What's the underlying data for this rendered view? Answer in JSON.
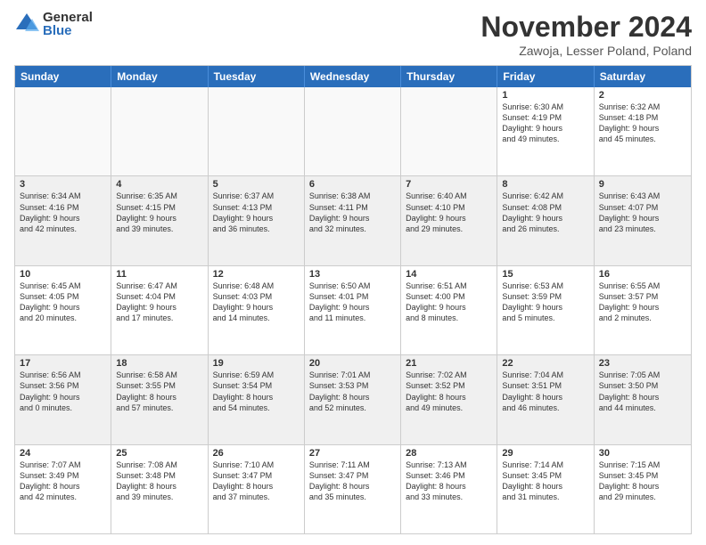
{
  "logo": {
    "general": "General",
    "blue": "Blue"
  },
  "title": {
    "month": "November 2024",
    "location": "Zawoja, Lesser Poland, Poland"
  },
  "calendar": {
    "headers": [
      "Sunday",
      "Monday",
      "Tuesday",
      "Wednesday",
      "Thursday",
      "Friday",
      "Saturday"
    ],
    "rows": [
      [
        {
          "day": "",
          "info": "",
          "empty": true
        },
        {
          "day": "",
          "info": "",
          "empty": true
        },
        {
          "day": "",
          "info": "",
          "empty": true
        },
        {
          "day": "",
          "info": "",
          "empty": true
        },
        {
          "day": "",
          "info": "",
          "empty": true
        },
        {
          "day": "1",
          "info": "Sunrise: 6:30 AM\nSunset: 4:19 PM\nDaylight: 9 hours\nand 49 minutes."
        },
        {
          "day": "2",
          "info": "Sunrise: 6:32 AM\nSunset: 4:18 PM\nDaylight: 9 hours\nand 45 minutes."
        }
      ],
      [
        {
          "day": "3",
          "info": "Sunrise: 6:34 AM\nSunset: 4:16 PM\nDaylight: 9 hours\nand 42 minutes."
        },
        {
          "day": "4",
          "info": "Sunrise: 6:35 AM\nSunset: 4:15 PM\nDaylight: 9 hours\nand 39 minutes."
        },
        {
          "day": "5",
          "info": "Sunrise: 6:37 AM\nSunset: 4:13 PM\nDaylight: 9 hours\nand 36 minutes."
        },
        {
          "day": "6",
          "info": "Sunrise: 6:38 AM\nSunset: 4:11 PM\nDaylight: 9 hours\nand 32 minutes."
        },
        {
          "day": "7",
          "info": "Sunrise: 6:40 AM\nSunset: 4:10 PM\nDaylight: 9 hours\nand 29 minutes."
        },
        {
          "day": "8",
          "info": "Sunrise: 6:42 AM\nSunset: 4:08 PM\nDaylight: 9 hours\nand 26 minutes."
        },
        {
          "day": "9",
          "info": "Sunrise: 6:43 AM\nSunset: 4:07 PM\nDaylight: 9 hours\nand 23 minutes."
        }
      ],
      [
        {
          "day": "10",
          "info": "Sunrise: 6:45 AM\nSunset: 4:05 PM\nDaylight: 9 hours\nand 20 minutes."
        },
        {
          "day": "11",
          "info": "Sunrise: 6:47 AM\nSunset: 4:04 PM\nDaylight: 9 hours\nand 17 minutes."
        },
        {
          "day": "12",
          "info": "Sunrise: 6:48 AM\nSunset: 4:03 PM\nDaylight: 9 hours\nand 14 minutes."
        },
        {
          "day": "13",
          "info": "Sunrise: 6:50 AM\nSunset: 4:01 PM\nDaylight: 9 hours\nand 11 minutes."
        },
        {
          "day": "14",
          "info": "Sunrise: 6:51 AM\nSunset: 4:00 PM\nDaylight: 9 hours\nand 8 minutes."
        },
        {
          "day": "15",
          "info": "Sunrise: 6:53 AM\nSunset: 3:59 PM\nDaylight: 9 hours\nand 5 minutes."
        },
        {
          "day": "16",
          "info": "Sunrise: 6:55 AM\nSunset: 3:57 PM\nDaylight: 9 hours\nand 2 minutes."
        }
      ],
      [
        {
          "day": "17",
          "info": "Sunrise: 6:56 AM\nSunset: 3:56 PM\nDaylight: 9 hours\nand 0 minutes."
        },
        {
          "day": "18",
          "info": "Sunrise: 6:58 AM\nSunset: 3:55 PM\nDaylight: 8 hours\nand 57 minutes."
        },
        {
          "day": "19",
          "info": "Sunrise: 6:59 AM\nSunset: 3:54 PM\nDaylight: 8 hours\nand 54 minutes."
        },
        {
          "day": "20",
          "info": "Sunrise: 7:01 AM\nSunset: 3:53 PM\nDaylight: 8 hours\nand 52 minutes."
        },
        {
          "day": "21",
          "info": "Sunrise: 7:02 AM\nSunset: 3:52 PM\nDaylight: 8 hours\nand 49 minutes."
        },
        {
          "day": "22",
          "info": "Sunrise: 7:04 AM\nSunset: 3:51 PM\nDaylight: 8 hours\nand 46 minutes."
        },
        {
          "day": "23",
          "info": "Sunrise: 7:05 AM\nSunset: 3:50 PM\nDaylight: 8 hours\nand 44 minutes."
        }
      ],
      [
        {
          "day": "24",
          "info": "Sunrise: 7:07 AM\nSunset: 3:49 PM\nDaylight: 8 hours\nand 42 minutes."
        },
        {
          "day": "25",
          "info": "Sunrise: 7:08 AM\nSunset: 3:48 PM\nDaylight: 8 hours\nand 39 minutes."
        },
        {
          "day": "26",
          "info": "Sunrise: 7:10 AM\nSunset: 3:47 PM\nDaylight: 8 hours\nand 37 minutes."
        },
        {
          "day": "27",
          "info": "Sunrise: 7:11 AM\nSunset: 3:47 PM\nDaylight: 8 hours\nand 35 minutes."
        },
        {
          "day": "28",
          "info": "Sunrise: 7:13 AM\nSunset: 3:46 PM\nDaylight: 8 hours\nand 33 minutes."
        },
        {
          "day": "29",
          "info": "Sunrise: 7:14 AM\nSunset: 3:45 PM\nDaylight: 8 hours\nand 31 minutes."
        },
        {
          "day": "30",
          "info": "Sunrise: 7:15 AM\nSunset: 3:45 PM\nDaylight: 8 hours\nand 29 minutes."
        }
      ]
    ]
  }
}
